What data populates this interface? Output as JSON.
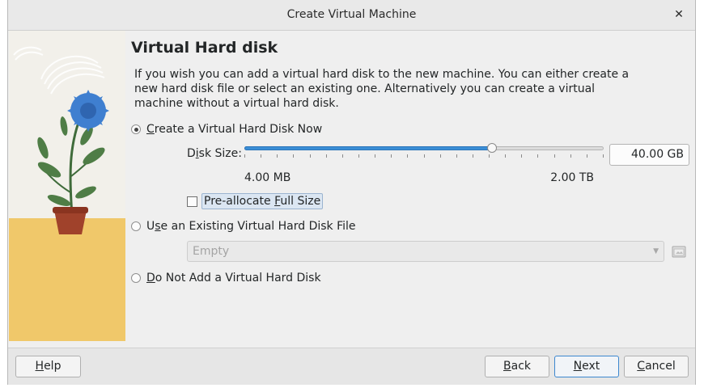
{
  "window": {
    "title": "Create Virtual Machine",
    "close_glyph": "✕"
  },
  "page": {
    "heading": "Virtual Hard disk",
    "description": "If you wish you can add a virtual hard disk to the new machine. You can either create a new hard disk file or select an existing one. Alternatively you can create a virtual machine without a virtual hard disk."
  },
  "options": {
    "create_now": {
      "prefix": "",
      "mnemonic": "C",
      "rest": "reate a Virtual Hard Disk Now",
      "selected": true
    },
    "use_existing": {
      "prefix": "U",
      "mnemonic": "s",
      "rest": "e an Existing Virtual Hard Disk File",
      "selected": false
    },
    "do_not_add": {
      "prefix": "",
      "mnemonic": "D",
      "rest": "o Not Add a Virtual Hard Disk",
      "selected": false
    }
  },
  "disk_size": {
    "label_prefix": "D",
    "label_mnemonic": "i",
    "label_rest": "sk Size:",
    "value": "40.00 GB",
    "slider_fraction": 0.69,
    "min_label": "4.00 MB",
    "max_label": "2.00 TB"
  },
  "preallocate": {
    "prefix": "Pre-allocate ",
    "mnemonic": "F",
    "rest": "ull Size",
    "checked": false
  },
  "existing_file": {
    "selected": "Empty",
    "enabled": false
  },
  "buttons": {
    "help": {
      "mnemonic": "H",
      "rest": "elp"
    },
    "back": {
      "mnemonic": "B",
      "rest": "ack"
    },
    "next": {
      "mnemonic": "N",
      "rest": "ext"
    },
    "cancel": {
      "mnemonic": "C",
      "rest": "ancel"
    }
  },
  "colors": {
    "accent": "#3b8ed6",
    "window_bg": "#efefef"
  },
  "icons": {
    "close": "close-icon",
    "combo_arrow": "chevron-down-icon",
    "folder": "folder-open-icon"
  }
}
